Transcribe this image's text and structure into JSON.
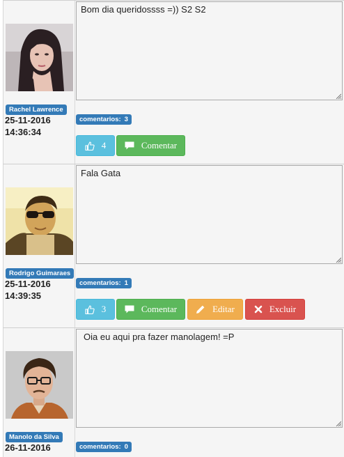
{
  "posts": [
    {
      "author": "Rachel Lawrence",
      "date": "25-11-2016",
      "time": "14:36:34",
      "message": "Bom dia queridossss =)) S2 S2",
      "comments_label": "comentarios:",
      "comments_count": "3",
      "likes": "4",
      "comment_button": "Comentar",
      "avatar_icon": "woman-portrait-photo"
    },
    {
      "author": "Rodrigo Guimaraes",
      "date": "25-11-2016",
      "time": "14:39:35",
      "message": "Fala Gata",
      "comments_label": "comentarios:",
      "comments_count": "1",
      "likes": "3",
      "comment_button": "Comentar",
      "edit_button": "Editar",
      "delete_button": "Excluir",
      "avatar_icon": "man-sunglasses-photo"
    },
    {
      "author": "Manolo da Silva",
      "date": "26-11-2016",
      "message": "Oia eu aqui pra fazer manolagem! =P",
      "comments_label": "comentarios:",
      "comments_count": "0",
      "avatar_icon": "man-glasses-photo"
    }
  ],
  "icons": {
    "like": "thumbs-up-icon",
    "comment": "comment-bubble-icon",
    "edit": "pencil-icon",
    "delete": "x-icon"
  },
  "colors": {
    "badge": "#337ab7",
    "like": "#5bc0de",
    "comment": "#5cb85c",
    "edit": "#f0ad4e",
    "delete": "#d9534f"
  }
}
